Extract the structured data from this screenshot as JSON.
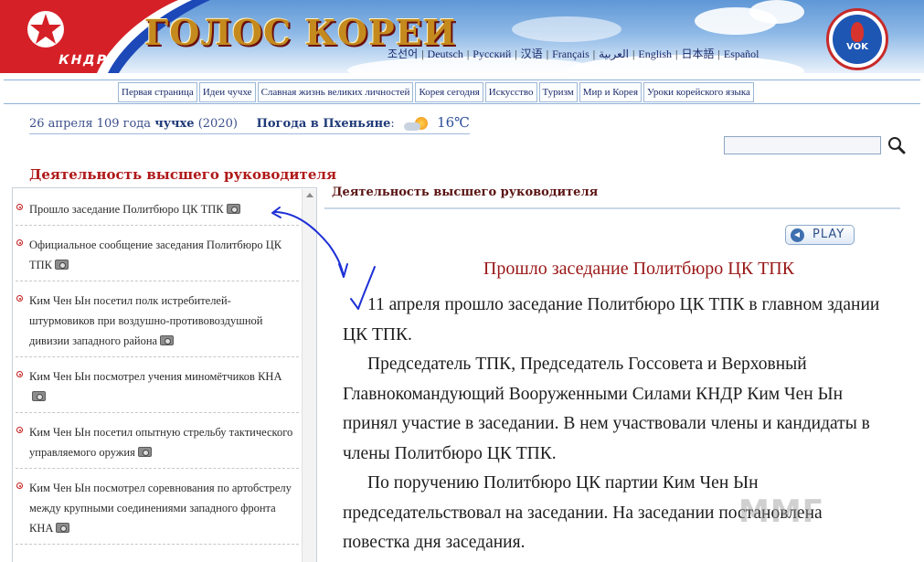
{
  "header": {
    "site_title": "ГОЛОС КОРЕИ",
    "flag_caption": "КНДР",
    "logo_text": "VOK",
    "languages": [
      "조선어",
      "Deutsch",
      "Русский",
      "汉语",
      "Français",
      "العربية",
      "English",
      "日本語",
      "Español"
    ]
  },
  "nav": {
    "items": [
      "Первая страница",
      "Идеи чучхе",
      "Славная жизнь великих личностей",
      "Корея сегодня",
      "Искусство",
      "Туризм",
      "Мир и Корея",
      "Уроки корейского языка"
    ]
  },
  "dateline": {
    "date": "26 апреля 109 года",
    "juche_word": "чучхе",
    "year": "(2020)",
    "weather_label": "Погода в Пхеньяне",
    "temperature": "16℃",
    "weather_icon": "partly-cloudy-icon"
  },
  "search": {
    "value": "",
    "icon": "magnifier-icon"
  },
  "sidebar": {
    "title": "Деятельность высшего руководителя",
    "items": [
      {
        "text": "Прошло заседание Политбюро ЦК ТПК",
        "photo": true
      },
      {
        "text": "Официальное сообщение заседания Политбюро ЦК ТПК",
        "photo": true
      },
      {
        "text": "Ким Чен Ын посетил полк истребителей-штурмовиков при воздушно-противовоздушной дивизии западного района",
        "photo": true
      },
      {
        "text": "Ким Чен Ын посмотрел учения миномётчиков КНА",
        "photo": true
      },
      {
        "text": "Ким Чен Ын посетил опытную стрельбу тактического управляемого оружия",
        "photo": true
      },
      {
        "text": "Ким Чен Ын посмотрел соревнования по артобстрелу между крупными соединениями западного фронта КНА",
        "photo": true
      }
    ]
  },
  "main": {
    "section_heading": "Деятельность высшего руководителя",
    "play_label": "PLAY",
    "article_title": "Прошло заседание Политбюро ЦК ТПК",
    "paragraphs": [
      "11 апреля прошло заседание Политбюро ЦК ТПК в главном здании ЦК ТПК.",
      "Председатель ТПК, Председатель Госсовета и Верховный Главнокомандующий Вооруженными Силами КНДР Ким Чен Ын принял участие в заседании. В нем участвовали члены и кандидаты в члены Политбюро ЦК ТПК.",
      "По поручению Политбюро ЦК партии Ким Чен Ын председательствовал на заседании. На заседании постановлена повестка дня заседания."
    ]
  },
  "watermark": "ММГ",
  "colors": {
    "accent_red": "#b01818",
    "nav_text": "#1d2c6b",
    "annotation_blue": "#1d2fd6"
  }
}
